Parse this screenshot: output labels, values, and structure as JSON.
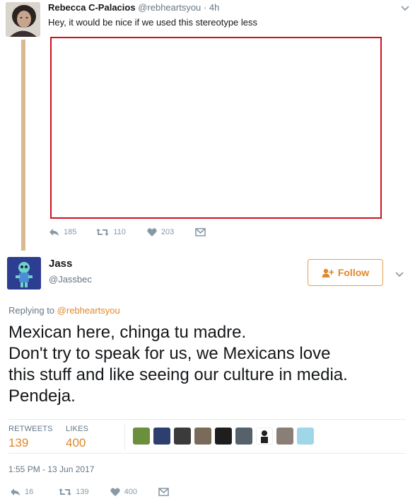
{
  "parent_tweet": {
    "name": "Rebecca C-Palacios",
    "handle": "@rebheartsyou",
    "separator": "·",
    "time": "4h",
    "text": "Hey, it would be nice if we used this stereotype less",
    "actions": {
      "reply_count": "185",
      "retweet_count": "110",
      "like_count": "203"
    },
    "media_border_color": "#d0121b"
  },
  "tweet": {
    "name": "Jass",
    "handle": "@Jassbec",
    "follow_label": "Follow",
    "replying_prefix": "Replying to",
    "replying_to": "@rebheartsyou",
    "text_lines": [
      "Mexican here, chinga tu madre.",
      "Don't try to speak for us, we Mexicans love",
      "this stuff and like seeing our culture in media.",
      "Pendeja."
    ],
    "stats": {
      "retweets_label": "RETWEETS",
      "retweets_value": "139",
      "likes_label": "LIKES",
      "likes_value": "400"
    },
    "timestamp": "1:55 PM - 13 Jun 2017",
    "actions": {
      "reply_count": "16",
      "retweet_count": "139",
      "like_count": "400"
    }
  },
  "icons": [
    "reply-icon",
    "retweet-icon",
    "heart-icon",
    "direct-message-icon",
    "chevron-down-icon",
    "follow-user-icon"
  ],
  "colors": {
    "accent": "#e0882b",
    "muted": "#657786",
    "action_gray": "#8899a6",
    "thread_line": "#d8b990"
  }
}
